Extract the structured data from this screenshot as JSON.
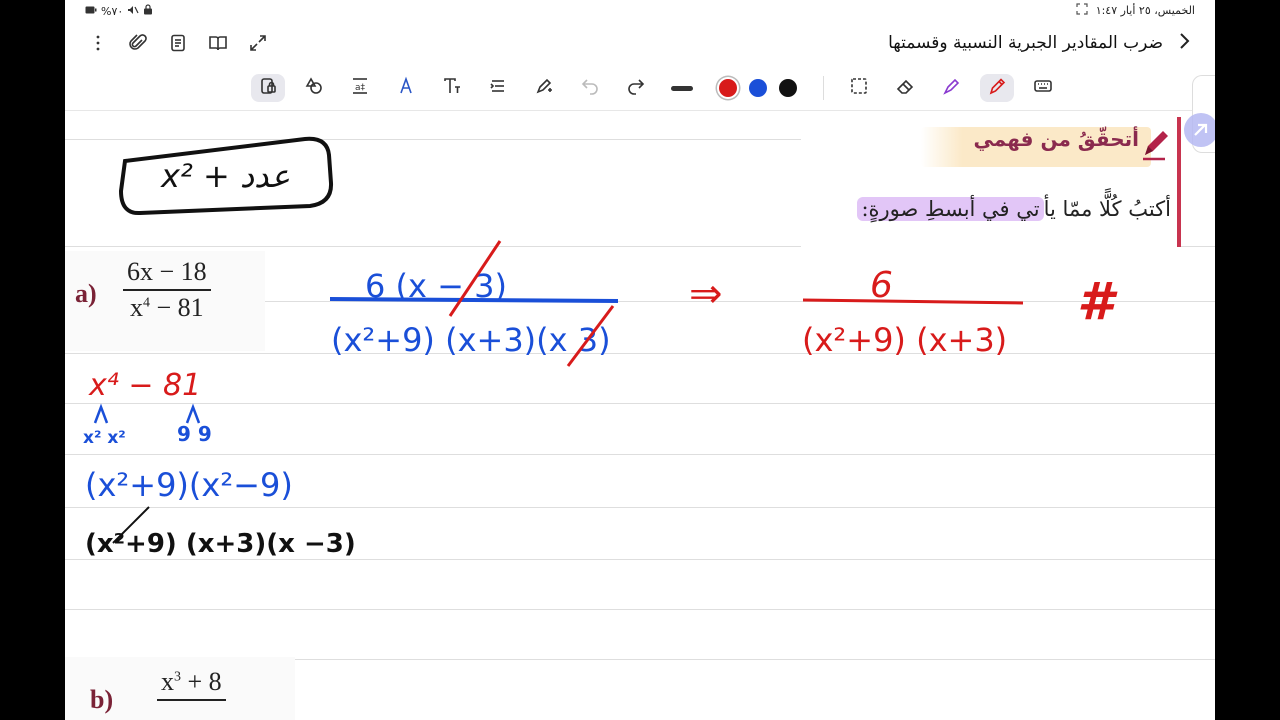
{
  "status": {
    "battery": "%٧٠",
    "datetime": "الخميس، ٢٥ أيار ١:٤٧"
  },
  "header": {
    "title": "ضرب المقادير الجبرية النسبية وقسمتها"
  },
  "toolbar": {
    "colors": [
      "#d81b1b",
      "#1a4fd8",
      "#111111"
    ],
    "selected_color": "#d81b1b"
  },
  "document": {
    "heading": "أتحقّقُ من فهمي",
    "instruction_pre": "أكتبُ كُلًّا ممّا يأ",
    "instruction_hl": "تي في أبسطِ صورةٍ:",
    "problem_a": {
      "label": "a)",
      "numerator": "6x − 18",
      "den_base": "x",
      "den_exp": "4",
      "den_rest": " − 81"
    },
    "problem_b": {
      "label": "b)",
      "num_base": "x",
      "num_exp": "3",
      "num_rest": " + 8"
    }
  },
  "handwriting": {
    "box_note": "x² + عدد",
    "red_expr": "x⁴ − 81",
    "factor_left": "x² x²",
    "factor_right": "9 9",
    "blue_line": "(x²+9)(x²−9)",
    "black_line": "(x²+9) (x+3)(x −3)",
    "blue_num": "6 (x − 3)",
    "blue_den": "(x²+9) (x+3)(x 3)",
    "arrow": "⇒",
    "red_num": "6",
    "red_den": "(x²+9) (x+3)",
    "hash": "#"
  }
}
